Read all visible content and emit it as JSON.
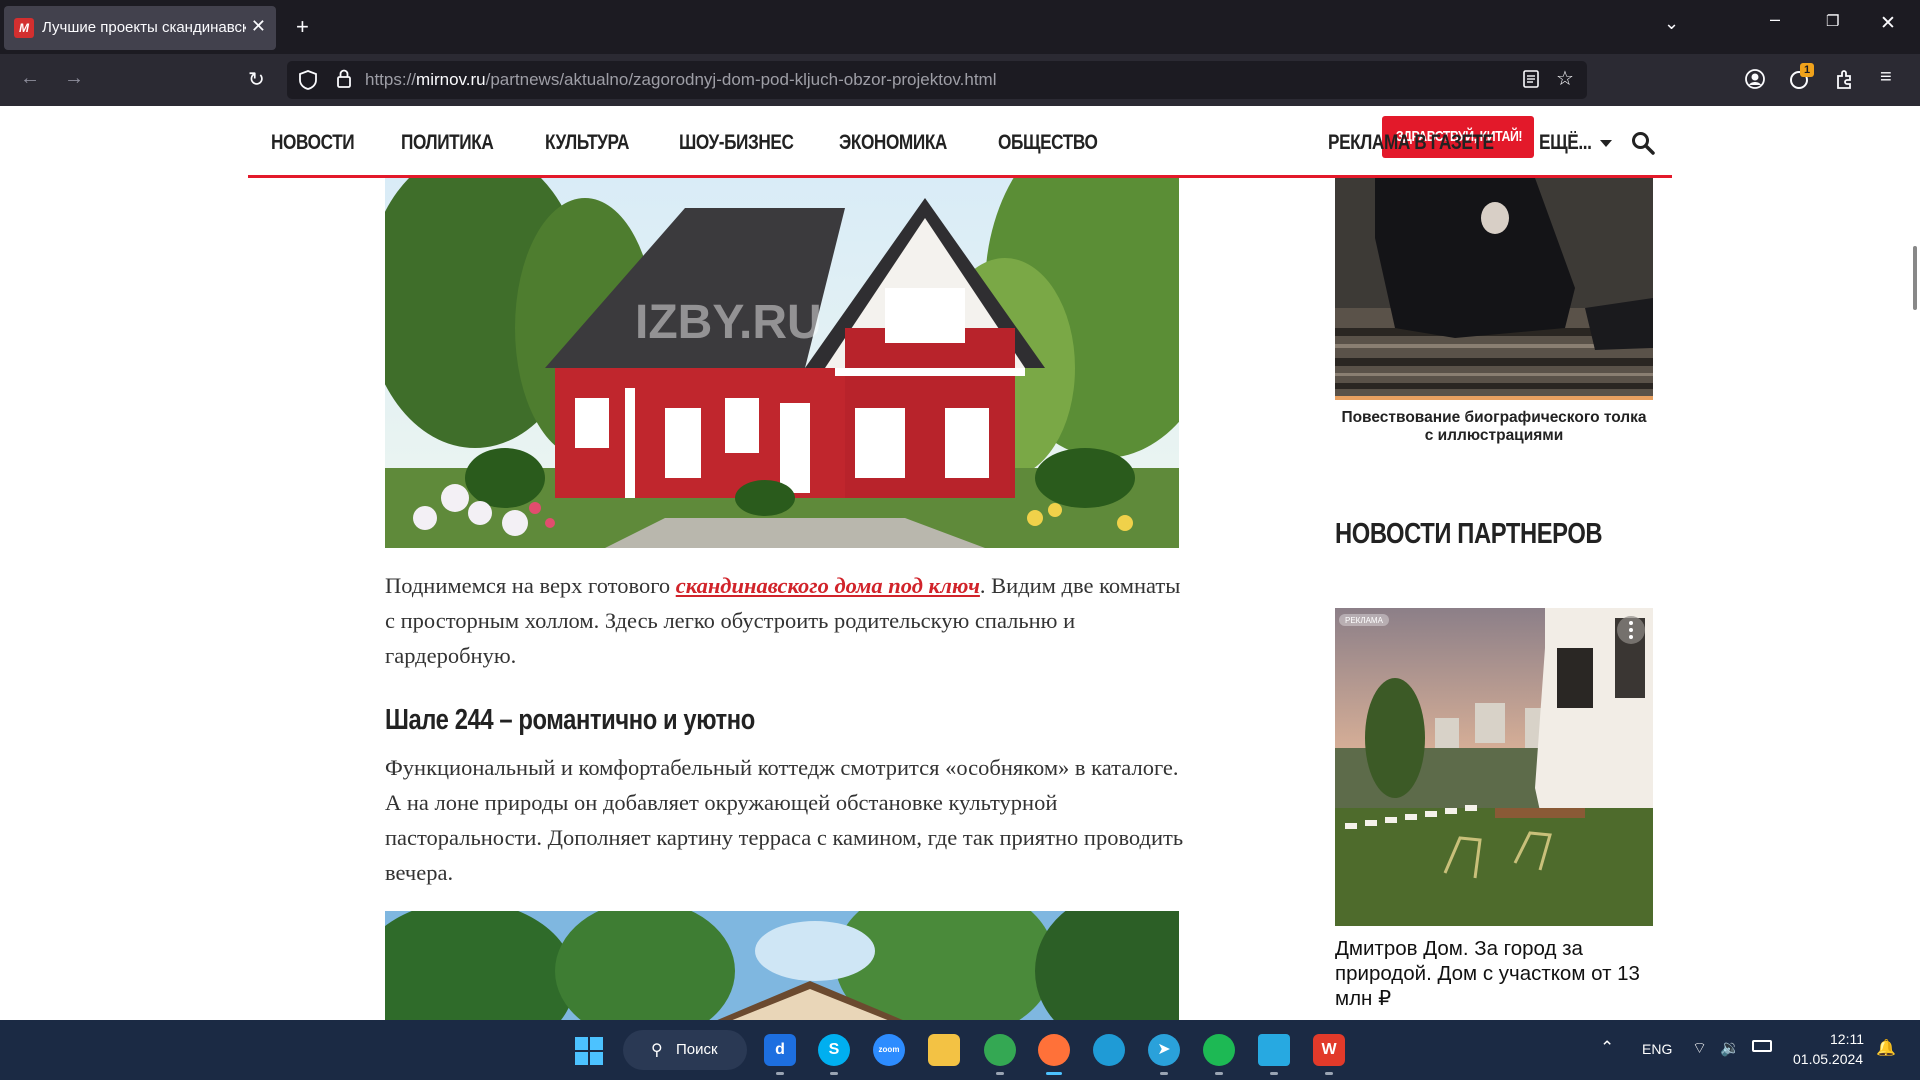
{
  "browser": {
    "tab_title": "Лучшие проекты скандинавских",
    "tab_close": "✕",
    "new_tab": "+",
    "url_prefix": "https://",
    "url_domain": "mirnov.ru",
    "url_path": "/partnews/aktualno/zagorodnyj-dom-pod-kljuch-obzor-projektov.html",
    "extension_badge": "1"
  },
  "site_nav": {
    "items": [
      "НОВОСТИ",
      "ПОЛИТИКА",
      "КУЛЬТУРА",
      "ШОУ-БИЗНЕС",
      "ЭКОНОМИКА",
      "ОБЩЕСТВО"
    ],
    "highlight": "ЗДРАВСТВУЙ, КИТАЙ!",
    "ad": "РЕКЛАМА В ГАЗЕТЕ",
    "more": "ЕЩЁ...",
    "accent_color": "#e3192a"
  },
  "article": {
    "paragraph1_before": "Поднимемся на верх готового ",
    "paragraph1_link": "скандинавского дома под ключ",
    "paragraph1_after": ". Видим две комнаты с просторным холлом. Здесь легко обустроить родительскую спальню и гардеробную.",
    "heading": "Шале 244 – романтично и уютно",
    "paragraph2": "Функциональный и комфортабельный коттедж смотрится «особняком» в каталоге. А на лоне природы он добавляет окружающей обстановке культурной пасторальности. Дополняет картину терраса с камином, где так приятно проводить вечера.",
    "watermark": "IZBY.RU"
  },
  "sidebar": {
    "book_caption": "Повествование биографического толка с иллюстрациями",
    "partners_title": "НОВОСТИ ПАРТНЕРОВ",
    "promo_label": "РЕКЛАМА",
    "promo_title": "Дмитров Дом. За город за природой. Дом с участком от 13 млн ₽"
  },
  "taskbar": {
    "search_label": "Поиск",
    "lang": "ENG",
    "time": "12:11",
    "date": "01.05.2024"
  }
}
